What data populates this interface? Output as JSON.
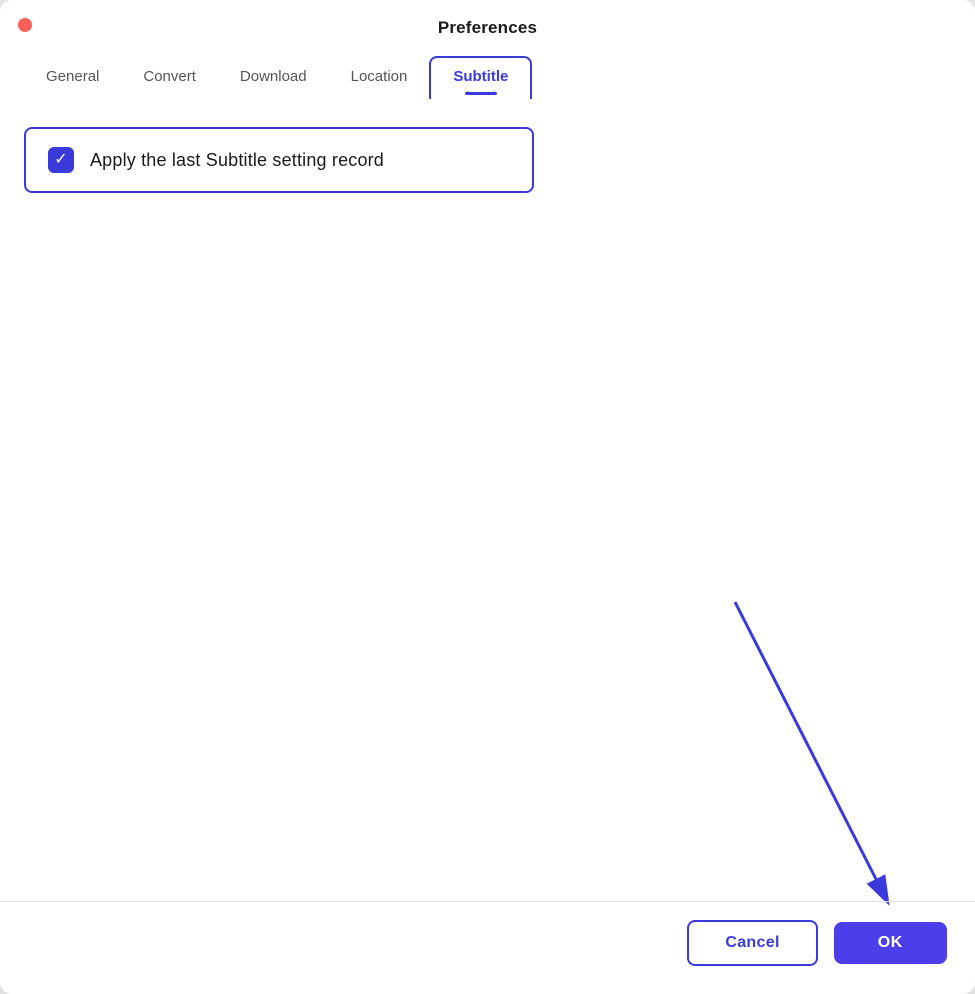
{
  "window": {
    "title": "Preferences"
  },
  "tabs": [
    {
      "id": "general",
      "label": "General",
      "active": false
    },
    {
      "id": "convert",
      "label": "Convert",
      "active": false
    },
    {
      "id": "download",
      "label": "Download",
      "active": false
    },
    {
      "id": "location",
      "label": "Location",
      "active": false
    },
    {
      "id": "subtitle",
      "label": "Subtitle",
      "active": true
    }
  ],
  "subtitle_tab": {
    "checkbox_label": "Apply the last Subtitle setting record",
    "checked": true
  },
  "buttons": {
    "cancel_label": "Cancel",
    "ok_label": "OK"
  },
  "colors": {
    "accent": "#4c3ee8",
    "close_btn": "#ff5f57"
  }
}
